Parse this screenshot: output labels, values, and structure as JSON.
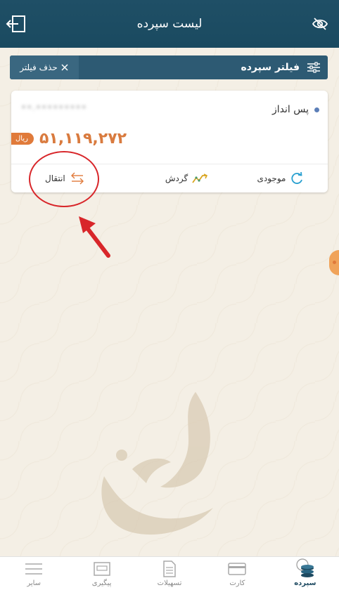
{
  "header": {
    "title": "لیست سپرده",
    "exit_icon": "exit-icon",
    "eye_icon": "eye-off-icon"
  },
  "filter": {
    "title": "فیلتر سپرده",
    "remove_label": "حذف فیلتر",
    "icon": "sliders-icon"
  },
  "card": {
    "name": "پس انداز",
    "account_number": "••.•••••••••",
    "currency": "ریال",
    "balance": "۵۱,۱۱۹,۲۷۲",
    "actions": {
      "balance_label": "موجودی",
      "turnover_label": "گردش",
      "transfer_label": "انتقال"
    }
  },
  "bottom_nav": {
    "items": [
      {
        "label": "سایر",
        "icon": "menu-icon"
      },
      {
        "label": "پیگیری",
        "icon": "tracking-icon"
      },
      {
        "label": "تسهیلات",
        "icon": "document-icon"
      },
      {
        "label": "کارت",
        "icon": "card-icon"
      },
      {
        "label": "سپرده",
        "icon": "deposit-coins-icon"
      }
    ]
  },
  "colors": {
    "header": "#1f4f66",
    "filter_bar": "#2d5a73",
    "accent": "#e07a3a",
    "annotation": "#d8262a"
  }
}
